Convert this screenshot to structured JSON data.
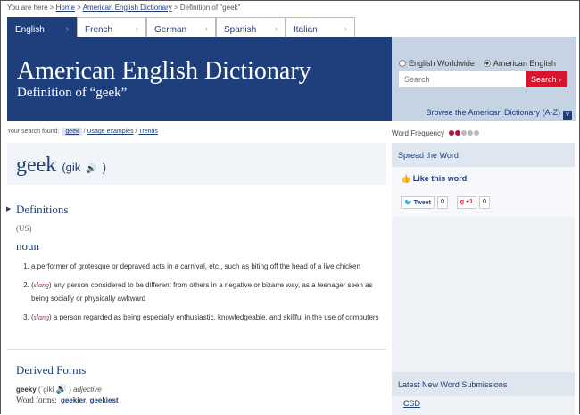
{
  "breadcrumb": {
    "prefix": "You are here",
    "items": [
      "Home",
      "American English Dictionary"
    ],
    "current": "Definition of \"geek\""
  },
  "tabs": [
    {
      "label": "English",
      "active": true
    },
    {
      "label": "French"
    },
    {
      "label": "German"
    },
    {
      "label": "Spanish"
    },
    {
      "label": "Italian"
    }
  ],
  "header": {
    "title": "American English Dictionary",
    "subtitle": "Definition of “geek”"
  },
  "search": {
    "options": [
      "English Worldwide",
      "American English"
    ],
    "selected": "American English",
    "placeholder": "Search",
    "button": "Search ›",
    "browse": "Browse the American Dictionary (A-Z)"
  },
  "found": {
    "label": "Your search found:",
    "items": [
      "geek",
      "Usage examples",
      "Trends"
    ]
  },
  "entry": {
    "word": "geek",
    "pron_open": "(gik",
    "pron_close": ")",
    "definitions_title": "Definitions",
    "region": "(US)",
    "pos": "noun",
    "senses": [
      {
        "label": "",
        "text": "a performer of grotesque or depraved acts in a carnival, etc., such as biting off the head of a live chicken"
      },
      {
        "label": "slang",
        "text": "any person considered to be different from others in a negative or bizarre way, as a teenager seen as being socially or physically awkward"
      },
      {
        "label": "slang",
        "text": "a person regarded as being especially enthusiastic, knowledgeable, and skillful in the use of computers"
      }
    ],
    "derived_title": "Derived Forms",
    "derived_word": "geeky",
    "derived_pron": "(ˈgiki",
    "derived_close": ")",
    "derived_pos": "adjective",
    "word_forms_label": "Word forms:",
    "word_forms": [
      "geekier",
      "geekiest"
    ]
  },
  "sidebar": {
    "frequency_label": "Word Frequency",
    "frequency_level": 2,
    "frequency_max": 5,
    "spread_title": "Spread the Word",
    "like": "Like this word",
    "tweet": "Tweet",
    "tweet_count": "0",
    "gplus": "+1",
    "gplus_count": "0",
    "latest_title": "Latest New Word Submissions",
    "latest_items": [
      "CSD"
    ]
  },
  "colors": {
    "brand": "#1f3f7c",
    "accent": "#d8152f"
  }
}
